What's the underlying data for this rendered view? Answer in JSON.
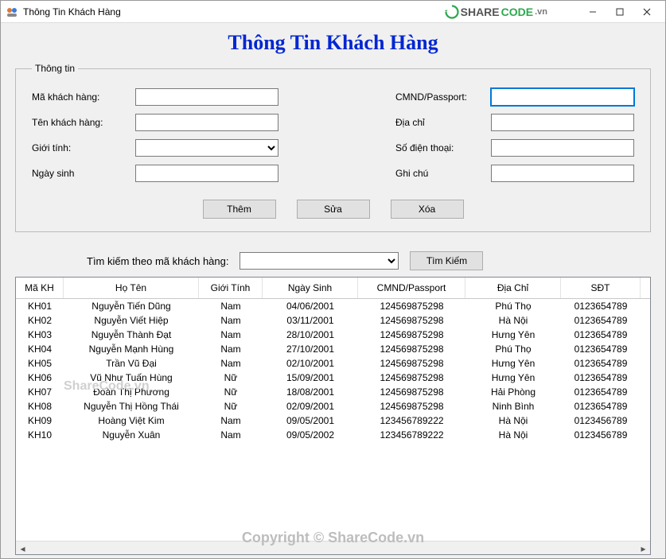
{
  "window": {
    "title": "Thông Tin Khách Hàng",
    "brand_main": "SHARE",
    "brand_accent": "CODE",
    "brand_tail": ".vn"
  },
  "page_title": "Thông Tin Khách Hàng",
  "legend": "Thông tin",
  "labels": {
    "ma_kh": "Mã khách hàng:",
    "ten_kh": "Tên khách hàng:",
    "gioi_tinh": "Giới tính:",
    "ngay_sinh": "Ngày sinh",
    "cmnd": "CMND/Passport:",
    "dia_chi": "Địa chỉ",
    "sdt": "Số điện thoại:",
    "ghi_chu": "Ghi chú"
  },
  "values": {
    "ma_kh": "",
    "ten_kh": "",
    "gioi_tinh": "",
    "ngay_sinh": "",
    "cmnd": "",
    "dia_chi": "",
    "sdt": "",
    "ghi_chu": ""
  },
  "buttons": {
    "them": "Thêm",
    "sua": "Sửa",
    "xoa": "Xóa",
    "tim_kiem": "Tìm Kiếm"
  },
  "search_label": "Tìm kiếm theo mã khách hàng:",
  "search_value": "",
  "columns": [
    "Mã KH",
    "Họ Tên",
    "Giới Tính",
    "Ngày Sinh",
    "CMND/Passport",
    "Địa Chỉ",
    "SĐT"
  ],
  "rows": [
    {
      "ma": "KH01",
      "ten": "Nguyễn Tiến Dũng",
      "gt": "Nam",
      "ns": "04/06/2001",
      "cmnd": "124569875298",
      "dc": "Phú Thọ",
      "sdt": "0123654789"
    },
    {
      "ma": "KH02",
      "ten": "Nguyễn Viết Hiệp",
      "gt": "Nam",
      "ns": "03/11/2001",
      "cmnd": "124569875298",
      "dc": "Hà Nội",
      "sdt": "0123654789"
    },
    {
      "ma": "KH03",
      "ten": "Nguyễn Thành Đạt",
      "gt": "Nam",
      "ns": "28/10/2001",
      "cmnd": "124569875298",
      "dc": "Hưng Yên",
      "sdt": "0123654789"
    },
    {
      "ma": "KH04",
      "ten": "Nguyễn Mạnh Hùng",
      "gt": "Nam",
      "ns": "27/10/2001",
      "cmnd": "124569875298",
      "dc": "Phú Thọ",
      "sdt": "0123654789"
    },
    {
      "ma": "KH05",
      "ten": "Trần Vũ Đại",
      "gt": "Nam",
      "ns": "02/10/2001",
      "cmnd": "124569875298",
      "dc": "Hưng Yên",
      "sdt": "0123654789"
    },
    {
      "ma": "KH06",
      "ten": "Vũ Như Tuấn Hùng",
      "gt": "Nữ",
      "ns": "15/09/2001",
      "cmnd": "124569875298",
      "dc": "Hưng Yên",
      "sdt": "0123654789"
    },
    {
      "ma": "KH07",
      "ten": "Đoàn Thị Phương",
      "gt": "Nữ",
      "ns": "18/08/2001",
      "cmnd": "124569875298",
      "dc": "Hải Phòng",
      "sdt": "0123654789"
    },
    {
      "ma": "KH08",
      "ten": "Nguyễn Thị Hồng Thái",
      "gt": "Nữ",
      "ns": "02/09/2001",
      "cmnd": "124569875298",
      "dc": "Ninh Bình",
      "sdt": "0123654789"
    },
    {
      "ma": "KH09",
      "ten": "Hoàng Việt Kim",
      "gt": "Nam",
      "ns": "09/05/2001",
      "cmnd": "123456789222",
      "dc": "Hà Nội",
      "sdt": "0123456789"
    },
    {
      "ma": "KH10",
      "ten": "Nguyễn Xuân",
      "gt": "Nam",
      "ns": "09/05/2002",
      "cmnd": "123456789222",
      "dc": "Hà Nội",
      "sdt": "0123456789"
    }
  ],
  "watermark_center": "Copyright © ShareCode.vn",
  "watermark_mid": "ShareCode.vn"
}
